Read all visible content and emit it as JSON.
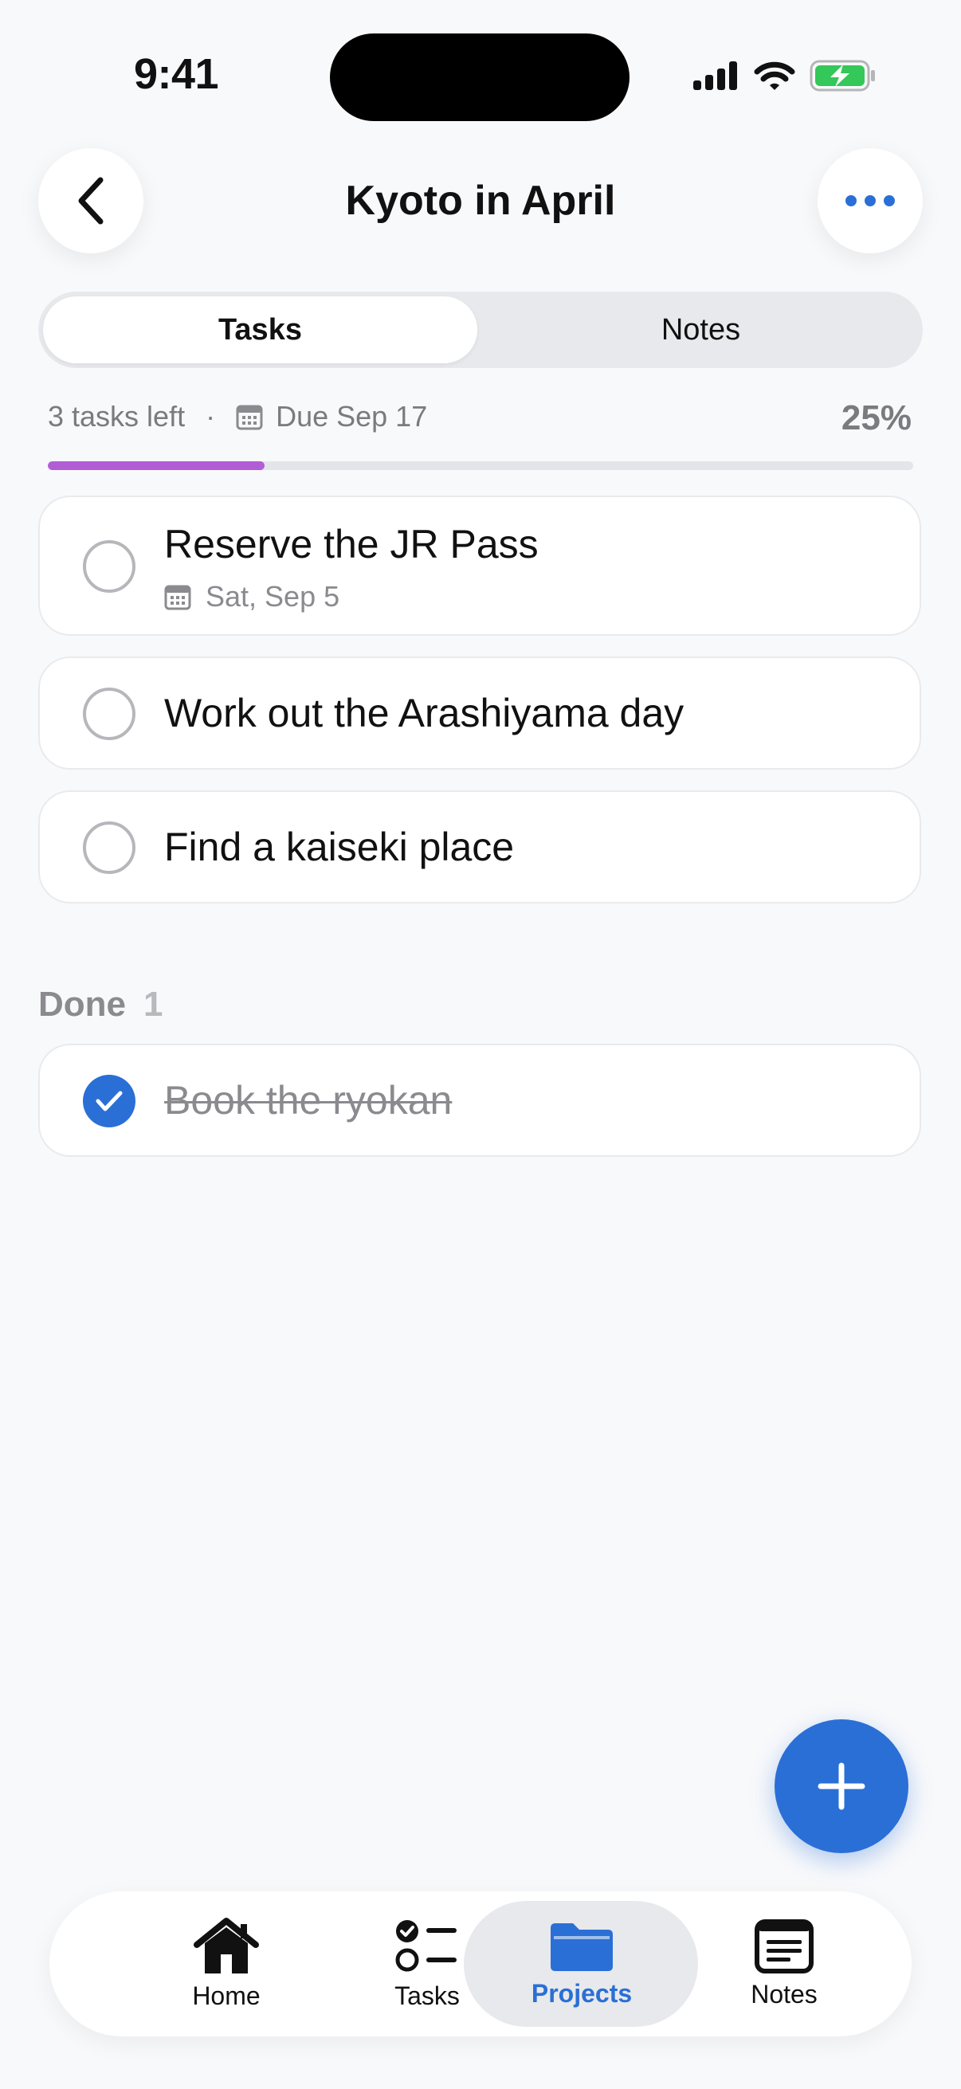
{
  "status": {
    "time": "9:41"
  },
  "header": {
    "title": "Kyoto in April"
  },
  "segment": {
    "tasks_label": "Tasks",
    "notes_label": "Notes"
  },
  "progress": {
    "tasks_left": "3 tasks left",
    "separator": "·",
    "due": "Due Sep 17",
    "percent_label": "25%",
    "fraction": 0.25
  },
  "tasks": [
    {
      "title": "Reserve the JR Pass",
      "date": "Sat, Sep 5"
    },
    {
      "title": "Work out the Arashiyama day"
    },
    {
      "title": "Find a kaiseki place"
    }
  ],
  "done_section": {
    "label": "Done",
    "count": "1",
    "tasks": [
      {
        "title": "Book the ryokan"
      }
    ]
  },
  "tabbar": {
    "items": [
      {
        "label": "Home",
        "icon": "house-icon"
      },
      {
        "label": "Tasks",
        "icon": "checklist-icon"
      },
      {
        "label": "Projects",
        "icon": "folder-icon",
        "active": true
      },
      {
        "label": "Notes",
        "icon": "note-icon"
      }
    ]
  },
  "colors": {
    "accent": "#2a6fd6",
    "progress": "#b15ed6",
    "background": "#f8f9fb"
  }
}
